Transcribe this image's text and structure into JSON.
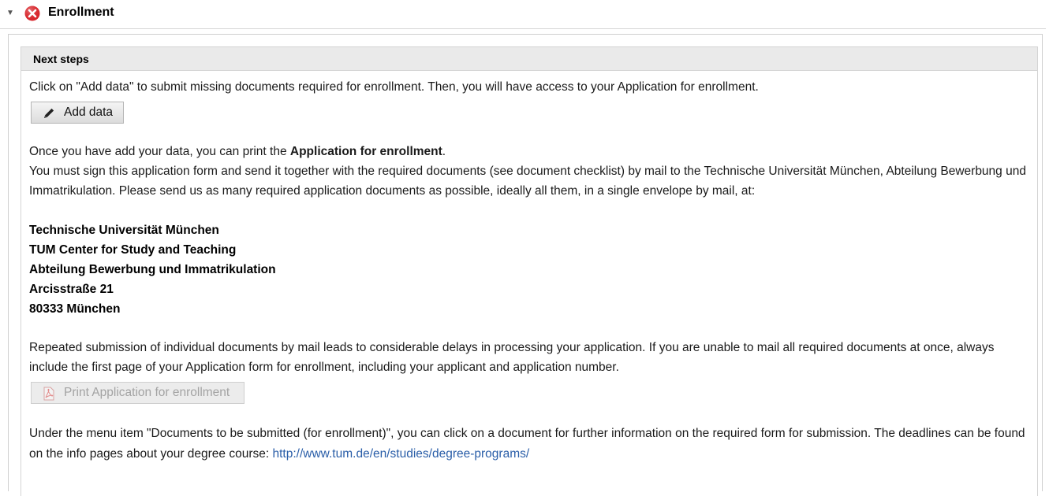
{
  "section": {
    "title": "Enrollment",
    "toggle_glyph": "▼",
    "status_icon": "error-x-icon",
    "status_color": "#d8262c"
  },
  "panel": {
    "title": "Next steps"
  },
  "intro": {
    "text": "Click on \"Add data\" to submit missing documents required for enrollment. Then, you will have access to your Application for enrollment."
  },
  "add_data_button": {
    "label": "Add data",
    "icon": "pencil-icon"
  },
  "print_info": {
    "line1_prefix": "Once you have add your data, you can print the ",
    "line1_bold": "Application for enrollment",
    "line1_suffix": ".",
    "line2": "You must sign this application form and send it together with the required documents (see document checklist) by mail to the Technische Universität München, Abteilung Bewerbung und Immatrikulation. Please send us as many required application documents as possible, ideally all them, in a single envelope by mail, at:"
  },
  "address": {
    "lines": [
      "Technische Universität München",
      "TUM Center for Study and Teaching",
      "Abteilung Bewerbung und Immatrikulation",
      "Arcisstraße 21",
      "80333 München"
    ]
  },
  "repeat_notice": {
    "text": "Repeated submission of individual documents by mail leads to considerable delays in processing your application. If you are unable to mail all required documents at once, always include the first page of your Application form for enrollment, including your applicant and application number."
  },
  "print_button": {
    "label": "Print Application for enrollment",
    "icon": "pdf-icon",
    "disabled": true
  },
  "menu_info": {
    "text": "Under the menu item \"Documents to be submitted (for enrollment)\", you can click on a document for further information on the required form for submission. The deadlines can be found on the info pages about your degree course: ",
    "link_text": "http://www.tum.de/en/studies/degree-programs/",
    "link_color": "#2a5ea8"
  }
}
